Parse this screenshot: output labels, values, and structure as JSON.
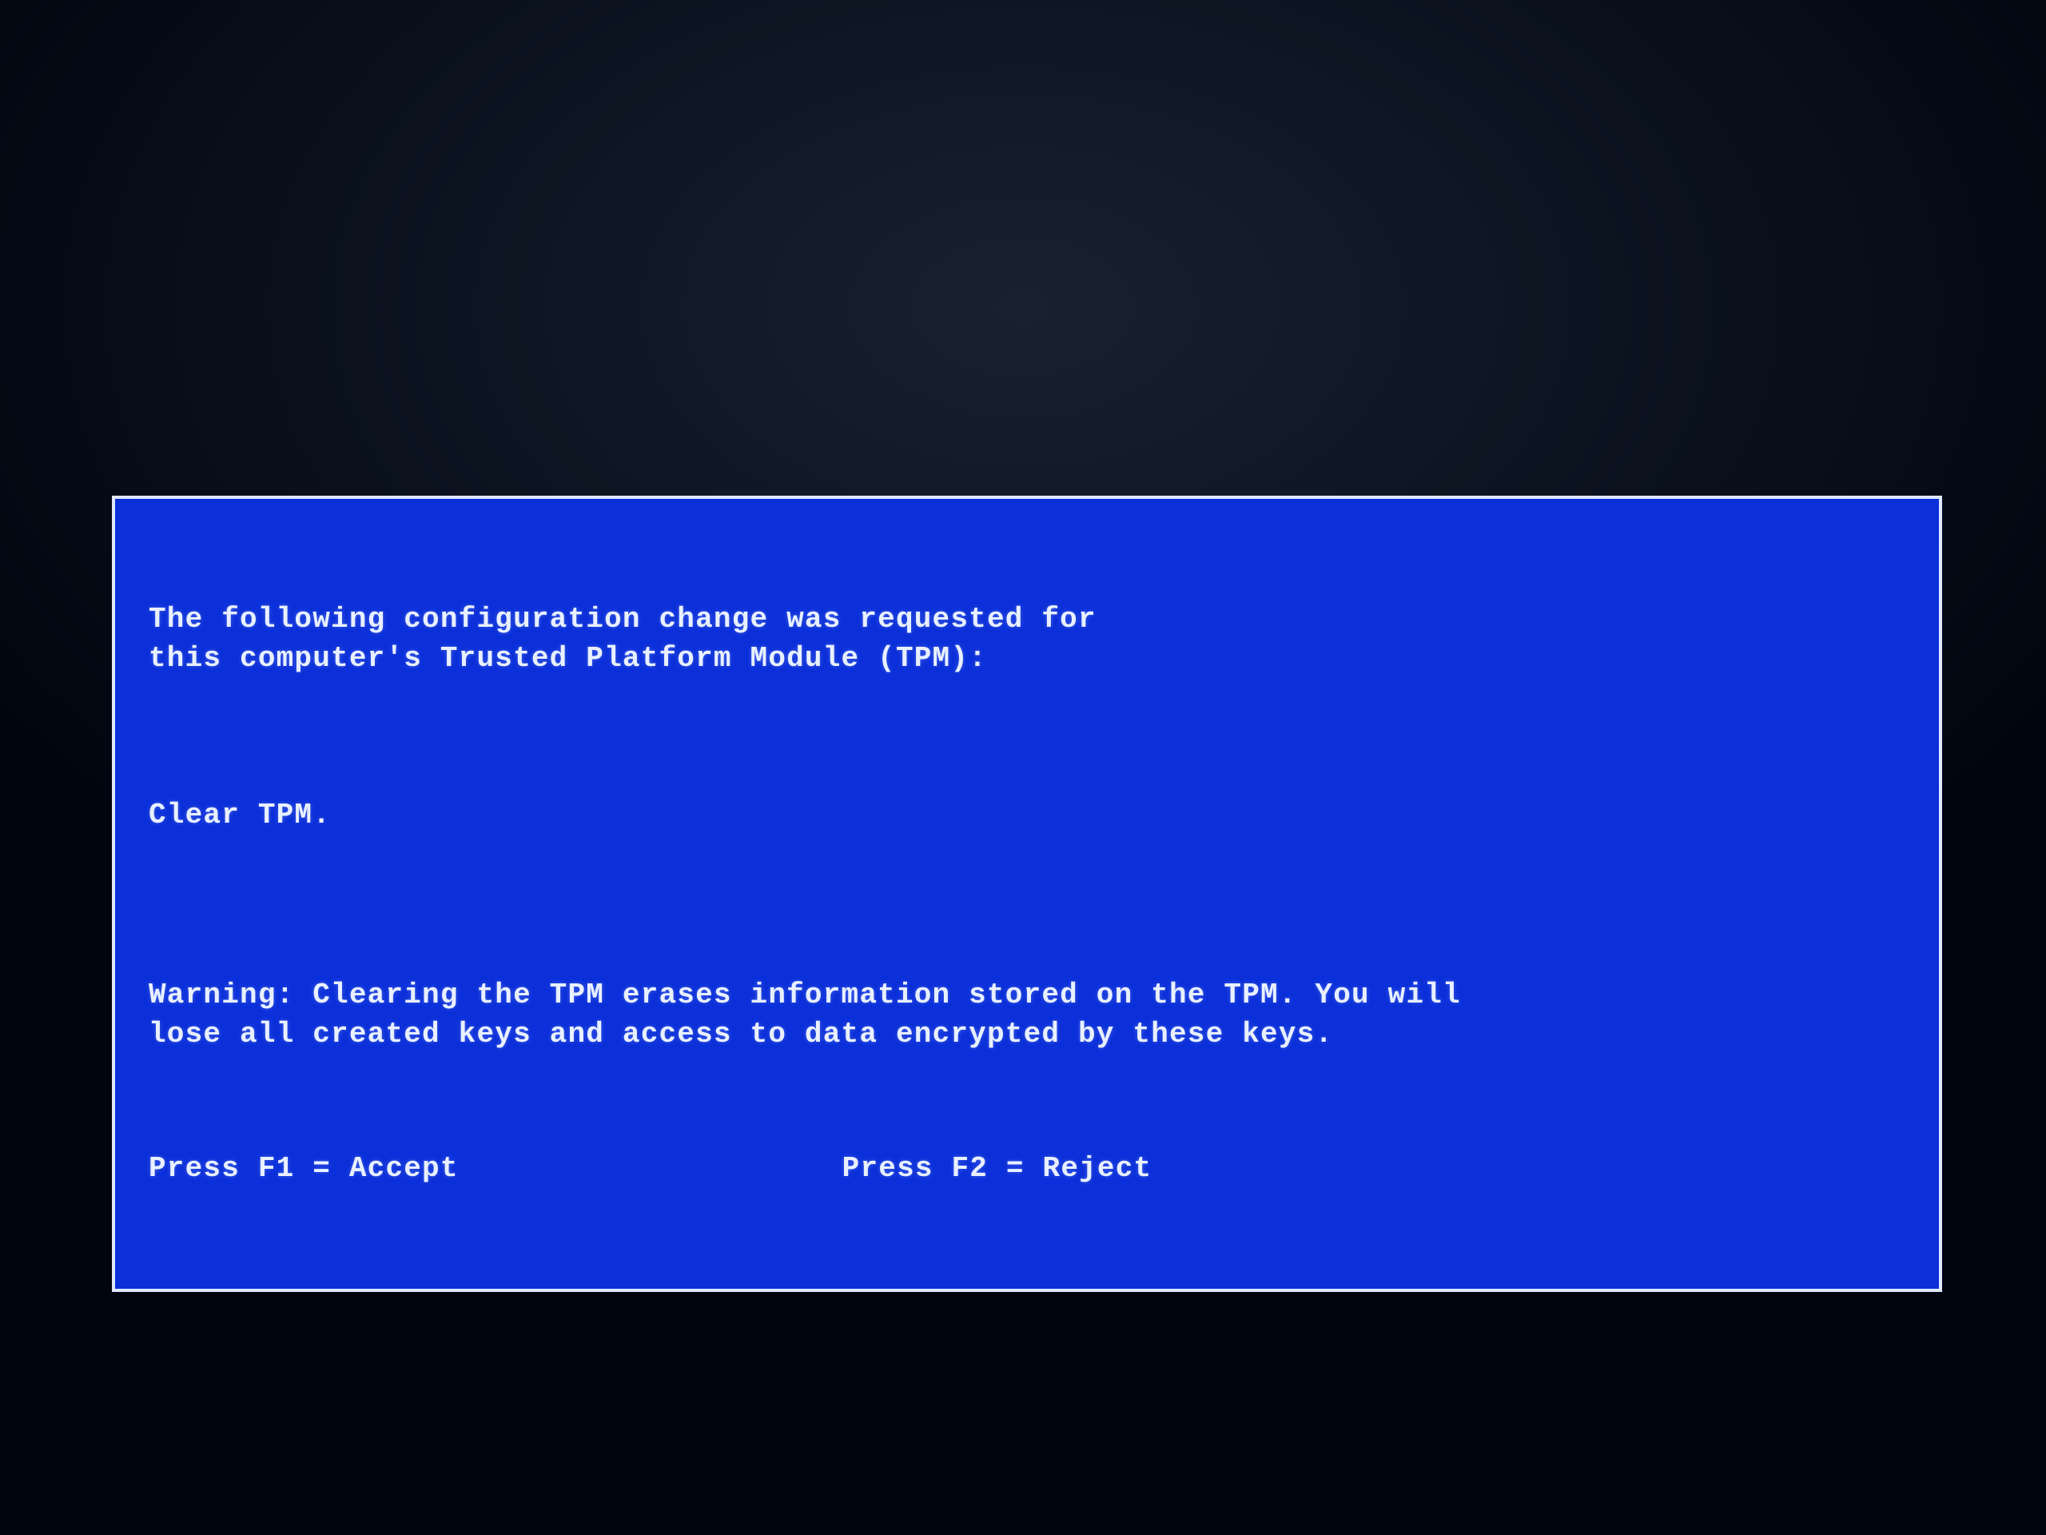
{
  "dialog": {
    "message_line1": "The following configuration change was requested for",
    "message_line2": "this computer's Trusted Platform Module (TPM):",
    "action": "Clear TPM.",
    "warning_line1": "Warning: Clearing the TPM erases information stored on the TPM. You will",
    "warning_line2": "lose all created keys and access to data encrypted by these keys.",
    "accept_label": "Press F1 = Accept",
    "reject_label": "Press F2 = Reject"
  }
}
